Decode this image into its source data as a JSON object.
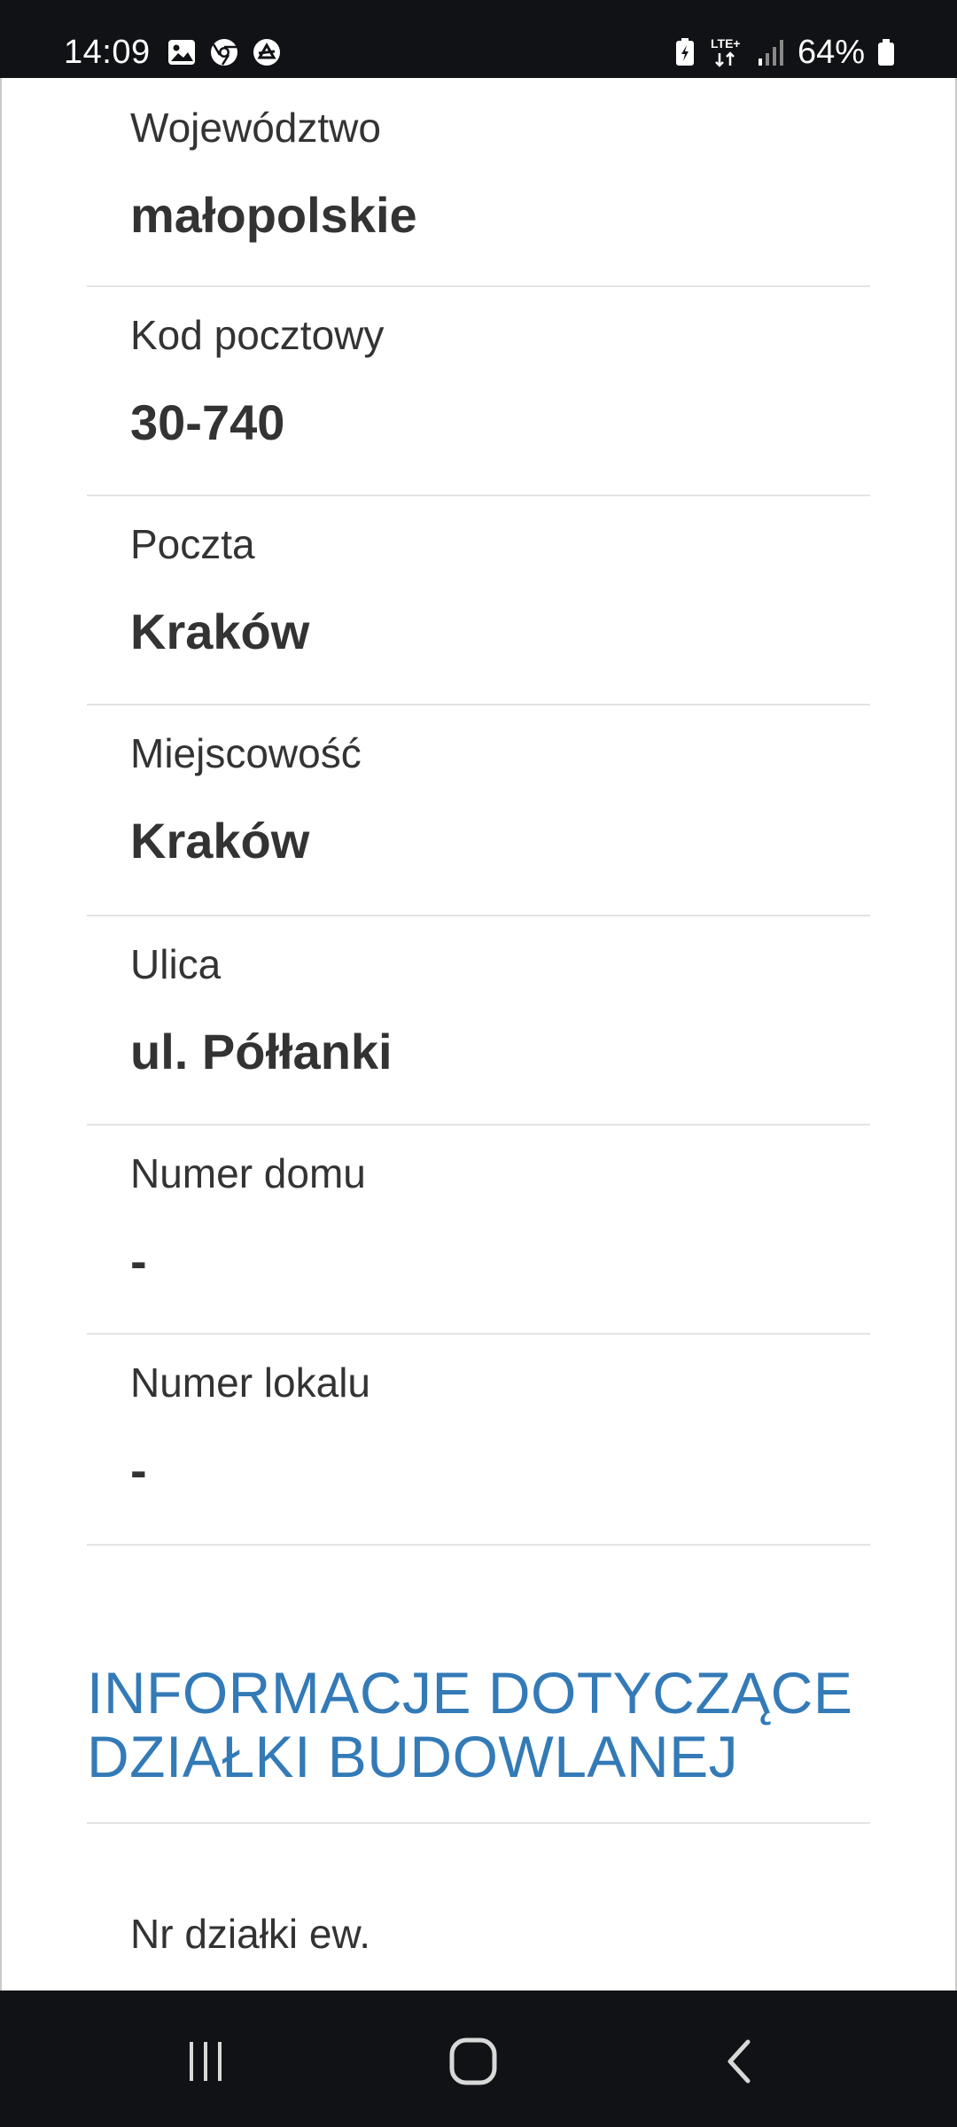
{
  "status_bar": {
    "time": "14:09",
    "network": "LTE+",
    "battery": "64%",
    "icons_left": [
      "gallery-icon",
      "chrome-icon",
      "app-icon"
    ]
  },
  "fields": [
    {
      "label": "Województwo",
      "value": "małopolskie"
    },
    {
      "label": "Kod pocztowy",
      "value": "30-740"
    },
    {
      "label": "Poczta",
      "value": "Kraków"
    },
    {
      "label": "Miejscowość",
      "value": "Kraków"
    },
    {
      "label": "Ulica",
      "value": "ul. Półłanki"
    },
    {
      "label": "Numer domu",
      "value": "-"
    },
    {
      "label": "Numer lokalu",
      "value": "-"
    }
  ],
  "section": {
    "heading_line1": "INFORMACJE DOTYCZĄCE",
    "heading_line2": "DZIAŁKI BUDOWLANEJ",
    "next_label": "Nr działki ew."
  },
  "nav": {
    "buttons": [
      "recent-apps-icon",
      "home-icon",
      "back-icon"
    ]
  },
  "colors": {
    "heading": "#337ab7",
    "text": "#333333",
    "bars": "#111216"
  }
}
